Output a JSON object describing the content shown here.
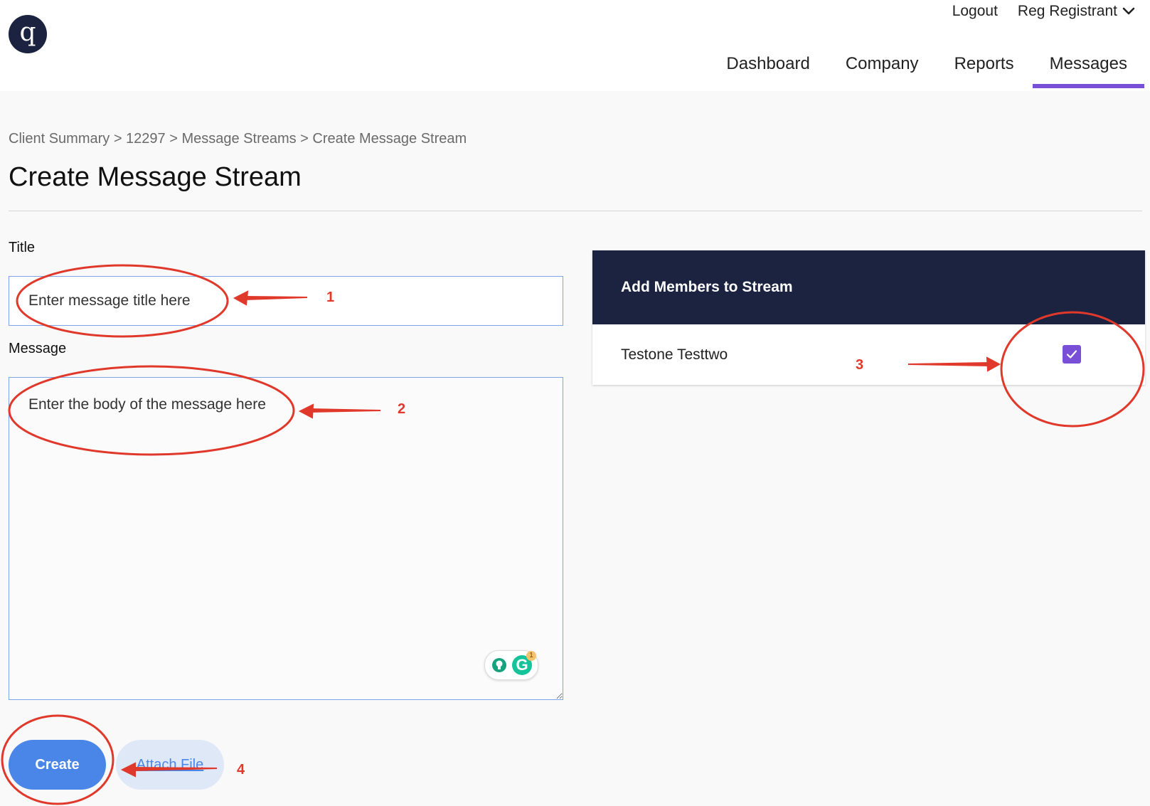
{
  "header": {
    "logo_letter": "q",
    "logout_label": "Logout",
    "user_name": "Reg Registrant",
    "nav": [
      {
        "label": "Dashboard"
      },
      {
        "label": "Company"
      },
      {
        "label": "Reports"
      },
      {
        "label": "Messages",
        "active": true
      }
    ]
  },
  "breadcrumb": "Client Summary > 12297 > Message Streams > Create Message Stream",
  "page_title": "Create Message Stream",
  "form": {
    "title_label": "Title",
    "title_placeholder": "Enter message title here",
    "title_value": "",
    "message_label": "Message",
    "message_placeholder": "Enter the body of the message here",
    "message_value": "",
    "create_label": "Create",
    "attach_label": "Attach File"
  },
  "members": {
    "header": "Add Members to Stream",
    "rows": [
      {
        "name": "Testone Testtwo",
        "checked": true
      }
    ]
  },
  "grammarly": {
    "letter": "G",
    "badge": "1"
  },
  "annotations": [
    "1",
    "2",
    "3",
    "4"
  ],
  "colors": {
    "accent": "#7a4fd8",
    "primary_button": "#4a86e8",
    "dark_header": "#1b2340",
    "annotation": "#e0392b"
  }
}
